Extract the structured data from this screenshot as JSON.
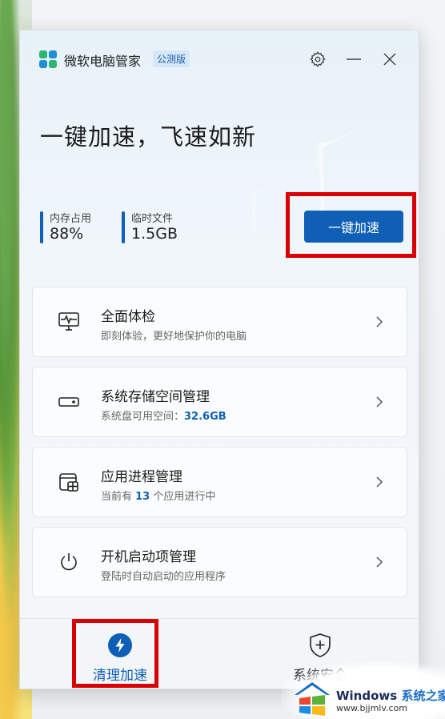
{
  "app": {
    "title": "微软电脑管家",
    "badge": "公测版",
    "settings_icon": "gear-icon",
    "minimize_icon": "minimize-icon",
    "close_icon": "close-icon"
  },
  "hero": {
    "title": "一键加速，飞速如新"
  },
  "stats": [
    {
      "label": "内存占用",
      "value": "88%"
    },
    {
      "label": "临时文件",
      "value": "1.5GB"
    }
  ],
  "speed_button": {
    "label": "一键加速"
  },
  "cards": [
    {
      "title": "全面体检",
      "subtitle": "即刻体验，更好地保护你的电脑",
      "icon": "monitor-pulse-icon"
    },
    {
      "title": "系统存储空间管理",
      "subtitle_prefix": "系统盘可用空间：",
      "subtitle_value": "32.6GB",
      "icon": "storage-drive-icon"
    },
    {
      "title": "应用进程管理",
      "subtitle_prefix": "当前有 ",
      "subtitle_value": "13",
      "subtitle_suffix": " 个应用进行中",
      "icon": "app-process-icon"
    },
    {
      "title": "开机启动项管理",
      "subtitle": "登陆时自动启动的应用程序",
      "icon": "power-icon"
    }
  ],
  "nav": [
    {
      "label": "清理加速",
      "active": true,
      "icon": "lightning-icon"
    },
    {
      "label": "系统安全",
      "active": false,
      "icon": "shield-plus-icon"
    }
  ],
  "watermark": {
    "brand": "Windows",
    "brand_cn": "系统之家",
    "url": "www.bjjmlv.com"
  },
  "colors": {
    "accent": "#0e5fb5",
    "highlight": "#d80000"
  }
}
